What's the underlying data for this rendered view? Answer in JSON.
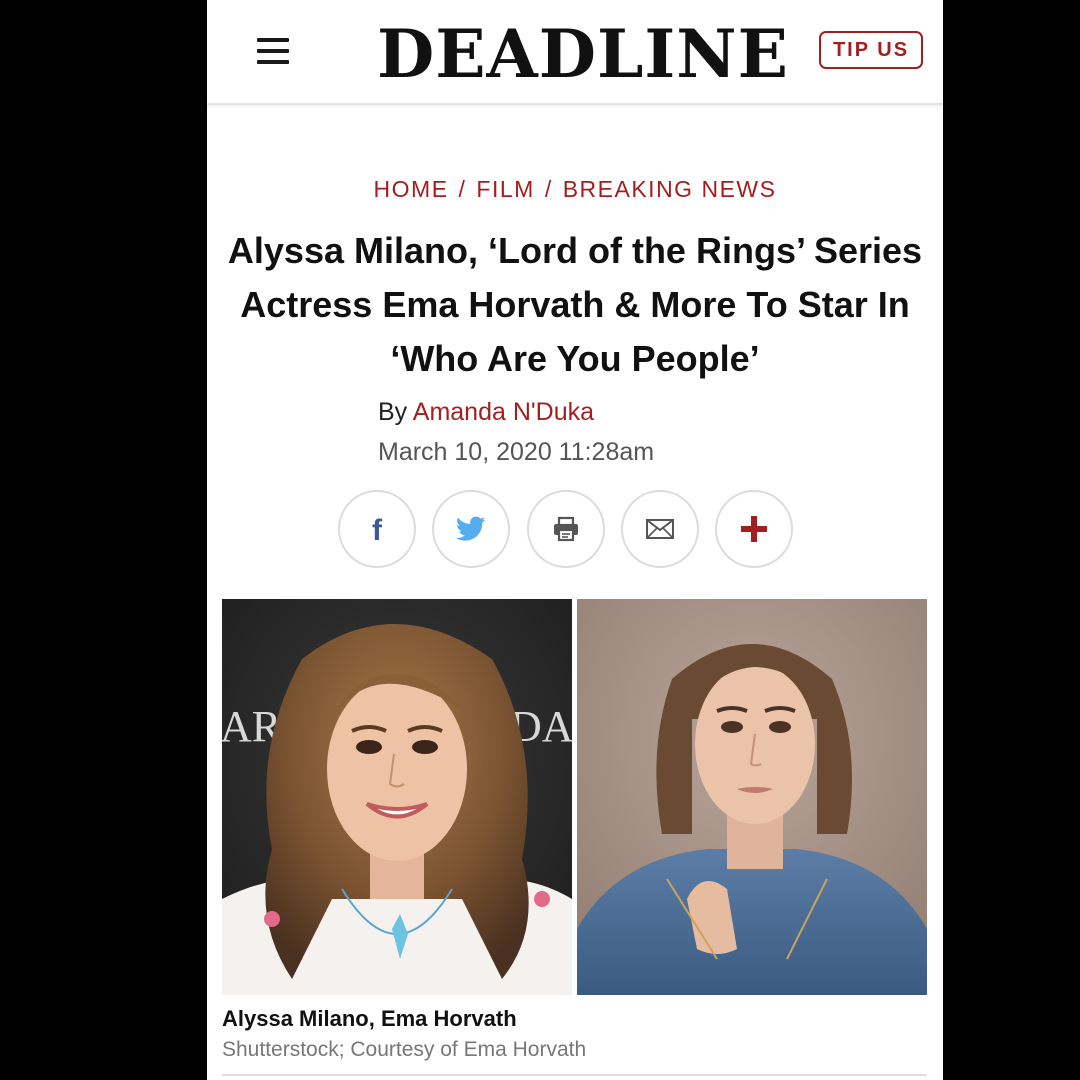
{
  "header": {
    "logo": "DEADLINE",
    "tip_label": "TIP US"
  },
  "breadcrumb": [
    "HOME",
    "FILM",
    "BREAKING NEWS"
  ],
  "article": {
    "headline": "Alyssa Milano, ‘Lord of the Rings’ Series Actress Ema Horvath & More To Star In ‘Who Are You People’",
    "by_prefix": "By",
    "author": "Amanda N'Duka",
    "date": "March 10, 2020 11:28am"
  },
  "share": [
    {
      "name": "facebook-icon",
      "color": "#3b5998"
    },
    {
      "name": "twitter-icon",
      "color": "#55acee"
    },
    {
      "name": "print-icon",
      "color": "#555555"
    },
    {
      "name": "email-icon",
      "color": "#555555"
    },
    {
      "name": "plus-icon",
      "color": "#a31f1f"
    }
  ],
  "photo": {
    "backdrop_text_left": "AR",
    "backdrop_text_right": "DA"
  },
  "caption": {
    "title": "Alyssa Milano, Ema Horvath",
    "credit": "Shutterstock; Courtesy of Ema Horvath"
  },
  "colors": {
    "accent": "#a31f1f",
    "text": "#111111"
  }
}
